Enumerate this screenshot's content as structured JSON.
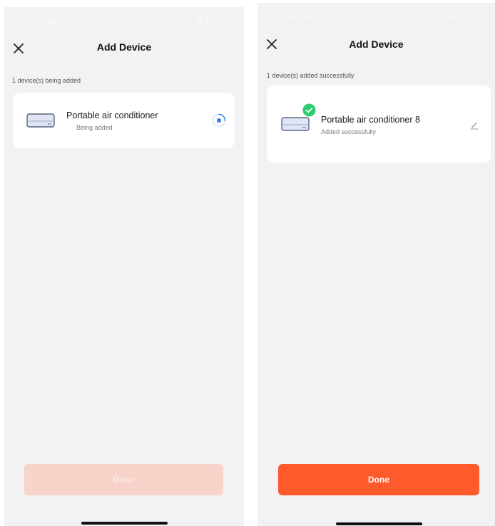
{
  "colors": {
    "background": "#f2f2f4",
    "card": "#ffffff",
    "accent": "#ff5a2c",
    "accent_disabled": "#f7d3c9",
    "progress_blue": "#2f7ff2",
    "success_green": "#2ecc71"
  },
  "left_screen": {
    "status_bar": {
      "time": "19:34"
    },
    "header": {
      "title": "Add Device",
      "close_icon": "close-icon"
    },
    "status_text": "1 device(s) being added",
    "device": {
      "name": "Portable air conditioner",
      "status": "Being added",
      "icon": "air-conditioner-icon",
      "indicator_icon": "loading-spinner-icon"
    },
    "done_button": {
      "label": "Done",
      "enabled": false
    }
  },
  "right_screen": {
    "status_bar": {
      "time": "19:34"
    },
    "header": {
      "title": "Add Device",
      "close_icon": "close-icon"
    },
    "status_text": "1 device(s) added successfully",
    "device": {
      "name": "Portable air conditioner 8",
      "status": "Added successfully",
      "icon": "air-conditioner-icon",
      "badge_icon": "check-badge-icon",
      "edit_icon": "pencil-icon"
    },
    "done_button": {
      "label": "Done",
      "enabled": true
    }
  }
}
